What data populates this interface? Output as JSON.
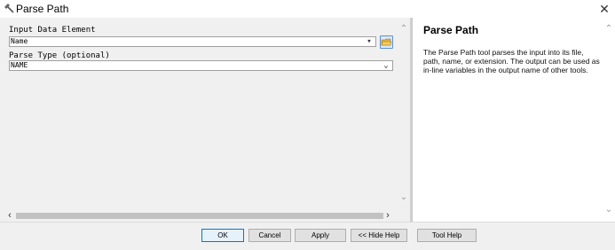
{
  "window": {
    "title": "Parse Path",
    "icons": {
      "title": "hammer-icon",
      "close": "close-icon"
    }
  },
  "form": {
    "input_label": "Input Data Element",
    "input_value": "Name",
    "parse_type_label": "Parse Type (optional)",
    "parse_type_value": "NAME"
  },
  "help": {
    "title": "Parse Path",
    "text": "The Parse Path tool parses the input into its file, path, name, or extension. The output can be used as in-line variables in the output name of other tools."
  },
  "buttons": {
    "ok": "OK",
    "cancel": "Cancel",
    "apply": "Apply",
    "hide_help": "<< Hide Help",
    "tool_help": "Tool Help"
  },
  "colors": {
    "accent": "#0078d7"
  }
}
